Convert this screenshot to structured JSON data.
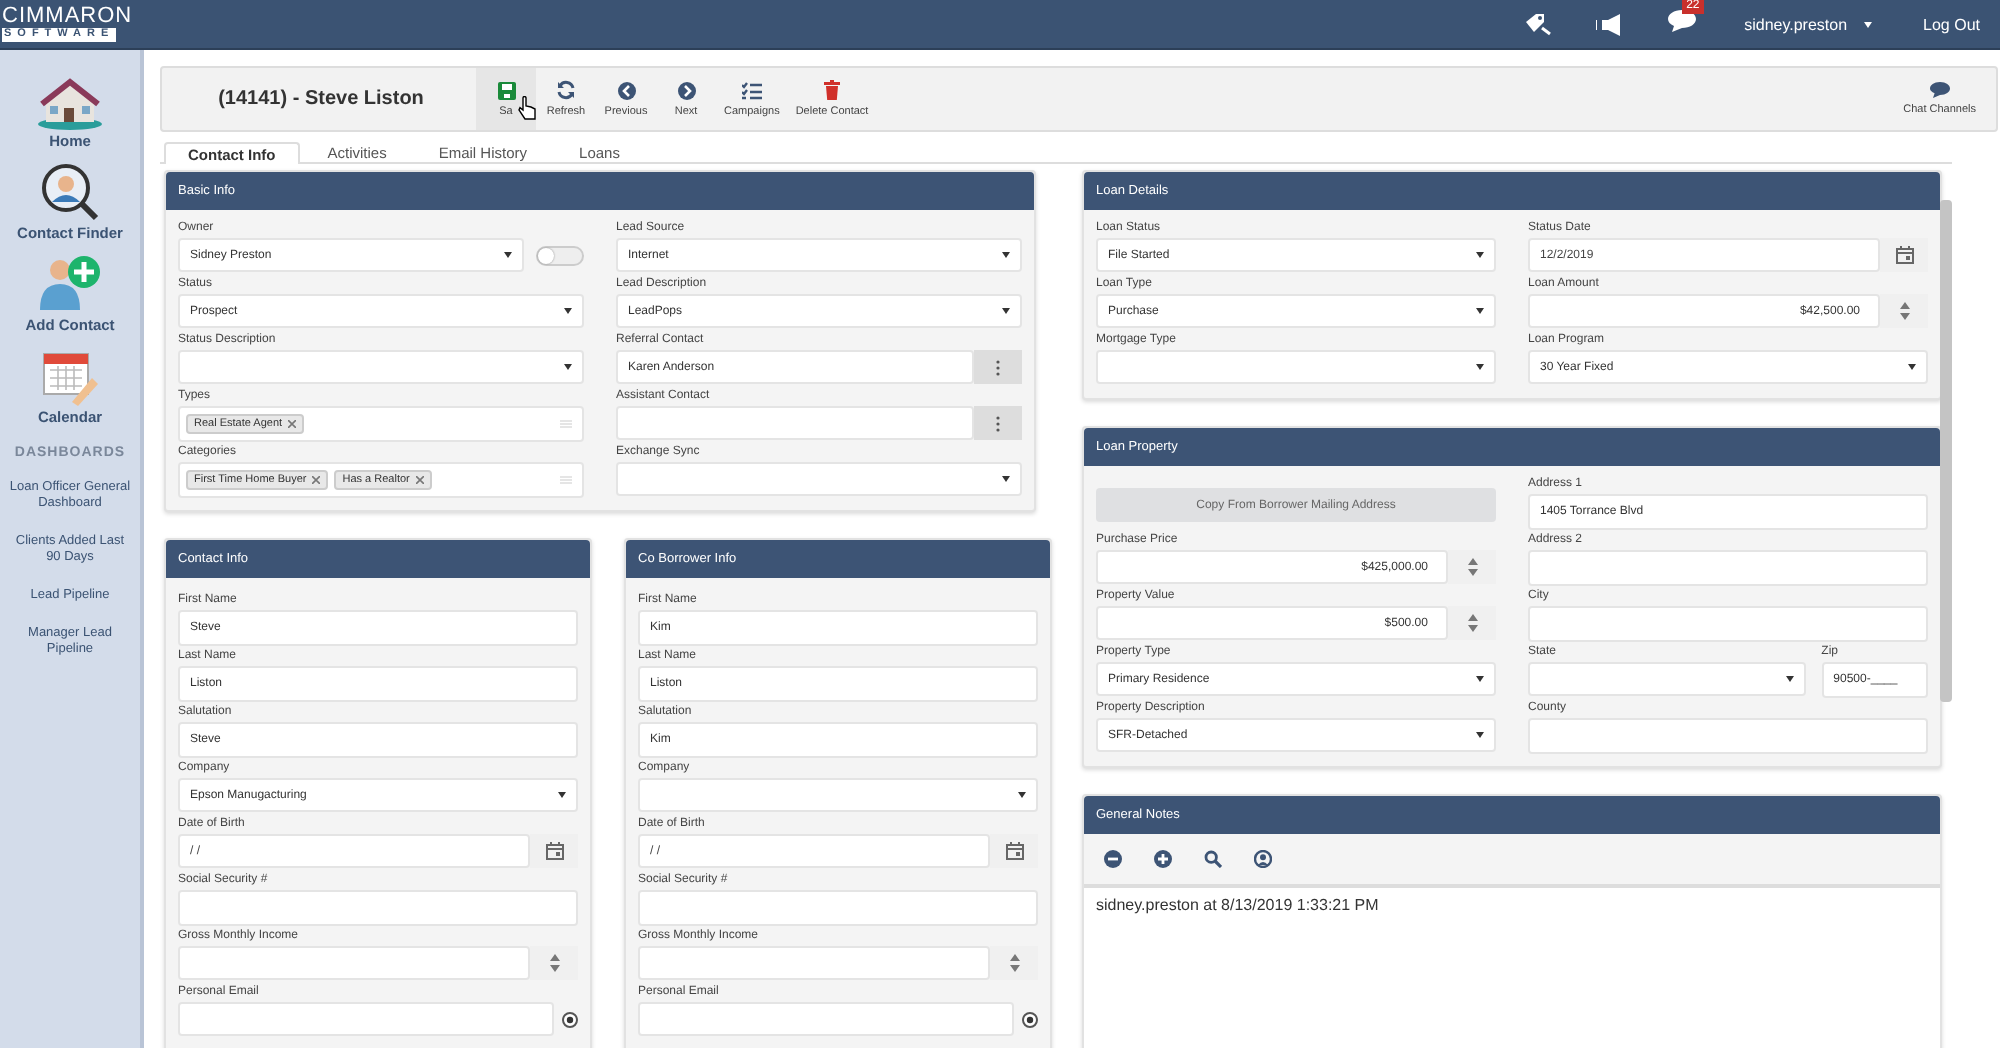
{
  "logo": {
    "line1": "CIMMARON",
    "line2": "SOFTWARE"
  },
  "top_bar": {
    "notification_count": "22",
    "user": "sidney.preston",
    "logout": "Log Out"
  },
  "sidebar": {
    "items": [
      {
        "label": "Home"
      },
      {
        "label": "Contact Finder"
      },
      {
        "label": "Add Contact"
      },
      {
        "label": "Calendar"
      }
    ],
    "section_heading": "DASHBOARDS",
    "links": [
      "Loan Officer General Dashboard",
      "Clients Added Last 90 Days",
      "Lead Pipeline",
      "Manager Lead Pipeline"
    ]
  },
  "toolbar": {
    "title": "(14141) - Steve Liston",
    "buttons": [
      {
        "label": "Sa",
        "kind": "save"
      },
      {
        "label": "Refresh",
        "kind": "refresh"
      },
      {
        "label": "Previous",
        "kind": "previous"
      },
      {
        "label": "Next",
        "kind": "next"
      },
      {
        "label": "Campaigns",
        "kind": "campaigns"
      },
      {
        "label": "Delete Contact",
        "kind": "delete"
      }
    ],
    "chat": "Chat Channels"
  },
  "tabs": [
    {
      "label": "Contact Info",
      "selected": true
    },
    {
      "label": "Activities",
      "selected": false
    },
    {
      "label": "Email History",
      "selected": false
    },
    {
      "label": "Loans",
      "selected": false
    }
  ],
  "basic_info": {
    "title": "Basic Info",
    "left": [
      {
        "label": "Owner",
        "kind": "select",
        "value": "Sidney Preston",
        "toggle": {
          "on": false
        }
      },
      {
        "label": "Status",
        "kind": "select",
        "value": "Prospect"
      },
      {
        "label": "Status Description",
        "kind": "select"
      },
      {
        "label": "Types",
        "kind": "tags",
        "tags": [
          "Real Estate Agent"
        ]
      },
      {
        "label": "Categories",
        "kind": "tags",
        "tags": [
          "First Time Home Buyer",
          "Has a Realtor"
        ]
      }
    ],
    "right": [
      {
        "label": "Lead Source",
        "kind": "select",
        "value": "Internet"
      },
      {
        "label": "Lead Description",
        "kind": "select",
        "value": "LeadPops"
      },
      {
        "label": "Referral Contact",
        "kind": "lookup",
        "value": "Karen Anderson"
      },
      {
        "label": "Assistant Contact",
        "kind": "lookup"
      },
      {
        "label": "Exchange Sync",
        "kind": "select"
      }
    ]
  },
  "contact_info": {
    "title": "Contact Info",
    "fields": [
      {
        "label": "First Name",
        "kind": "text",
        "value": "Steve"
      },
      {
        "label": "Last Name",
        "kind": "text",
        "value": "Liston"
      },
      {
        "label": "Salutation",
        "kind": "text",
        "value": "Steve"
      },
      {
        "label": "Company",
        "kind": "select",
        "value": "Epson Manugacturing"
      },
      {
        "label": "Date of Birth",
        "kind": "date",
        "value": "/ /"
      },
      {
        "label": "Social Security #",
        "kind": "text"
      },
      {
        "label": "Gross Monthly Income",
        "kind": "number"
      },
      {
        "label": "Personal Email",
        "kind": "email"
      }
    ]
  },
  "co_borrower_info": {
    "title": "Co Borrower Info",
    "fields": [
      {
        "label": "First Name",
        "kind": "text",
        "value": "Kim"
      },
      {
        "label": "Last Name",
        "kind": "text",
        "value": "Liston"
      },
      {
        "label": "Salutation",
        "kind": "text",
        "value": "Kim"
      },
      {
        "label": "Company",
        "kind": "select"
      },
      {
        "label": "Date of Birth",
        "kind": "date",
        "value": "/ /"
      },
      {
        "label": "Social Security #",
        "kind": "text"
      },
      {
        "label": "Gross Monthly Income",
        "kind": "number"
      },
      {
        "label": "Personal Email",
        "kind": "email"
      }
    ]
  },
  "loan_details": {
    "title": "Loan Details",
    "left": [
      {
        "label": "Loan Status",
        "kind": "select",
        "value": "File Started"
      },
      {
        "label": "Loan Type",
        "kind": "select",
        "value": "Purchase"
      },
      {
        "label": "Mortgage Type",
        "kind": "select"
      }
    ],
    "right": [
      {
        "label": "Status Date",
        "kind": "date",
        "value": "12/2/2019"
      },
      {
        "label": "Loan Amount",
        "kind": "number",
        "value": "$42,500.00"
      },
      {
        "label": "Loan Program",
        "kind": "select",
        "value": "30 Year Fixed"
      }
    ]
  },
  "loan_property": {
    "title": "Loan Property",
    "left": [
      {
        "label": "Copy From Borrower Mailing Address",
        "kind": "button"
      },
      {
        "label": "Purchase Price",
        "kind": "number",
        "value": "$425,000.00"
      },
      {
        "label": "Property Value",
        "kind": "number",
        "value": "$500.00"
      },
      {
        "label": "Property Type",
        "kind": "select",
        "value": "Primary Residence"
      },
      {
        "label": "Property Description",
        "kind": "select",
        "value": "SFR-Detached"
      }
    ],
    "right": [
      {
        "label": "Address 1",
        "kind": "text",
        "value": "1405 Torrance Blvd"
      },
      {
        "label": "Address 2",
        "kind": "text"
      },
      {
        "label": "City",
        "kind": "text"
      },
      {
        "kind": "pair",
        "fields": [
          {
            "label": "State",
            "kind": "select"
          },
          {
            "label": "Zip",
            "kind": "text",
            "value": "90500-____"
          }
        ]
      },
      {
        "label": "County",
        "kind": "text"
      }
    ]
  },
  "general_notes": {
    "title": "General Notes",
    "tools": [
      {
        "kind": "minus"
      },
      {
        "kind": "plus"
      },
      {
        "kind": "search"
      },
      {
        "kind": "user"
      }
    ],
    "note": "sidney.preston at 8/13/2019 1:33:21 PM"
  }
}
